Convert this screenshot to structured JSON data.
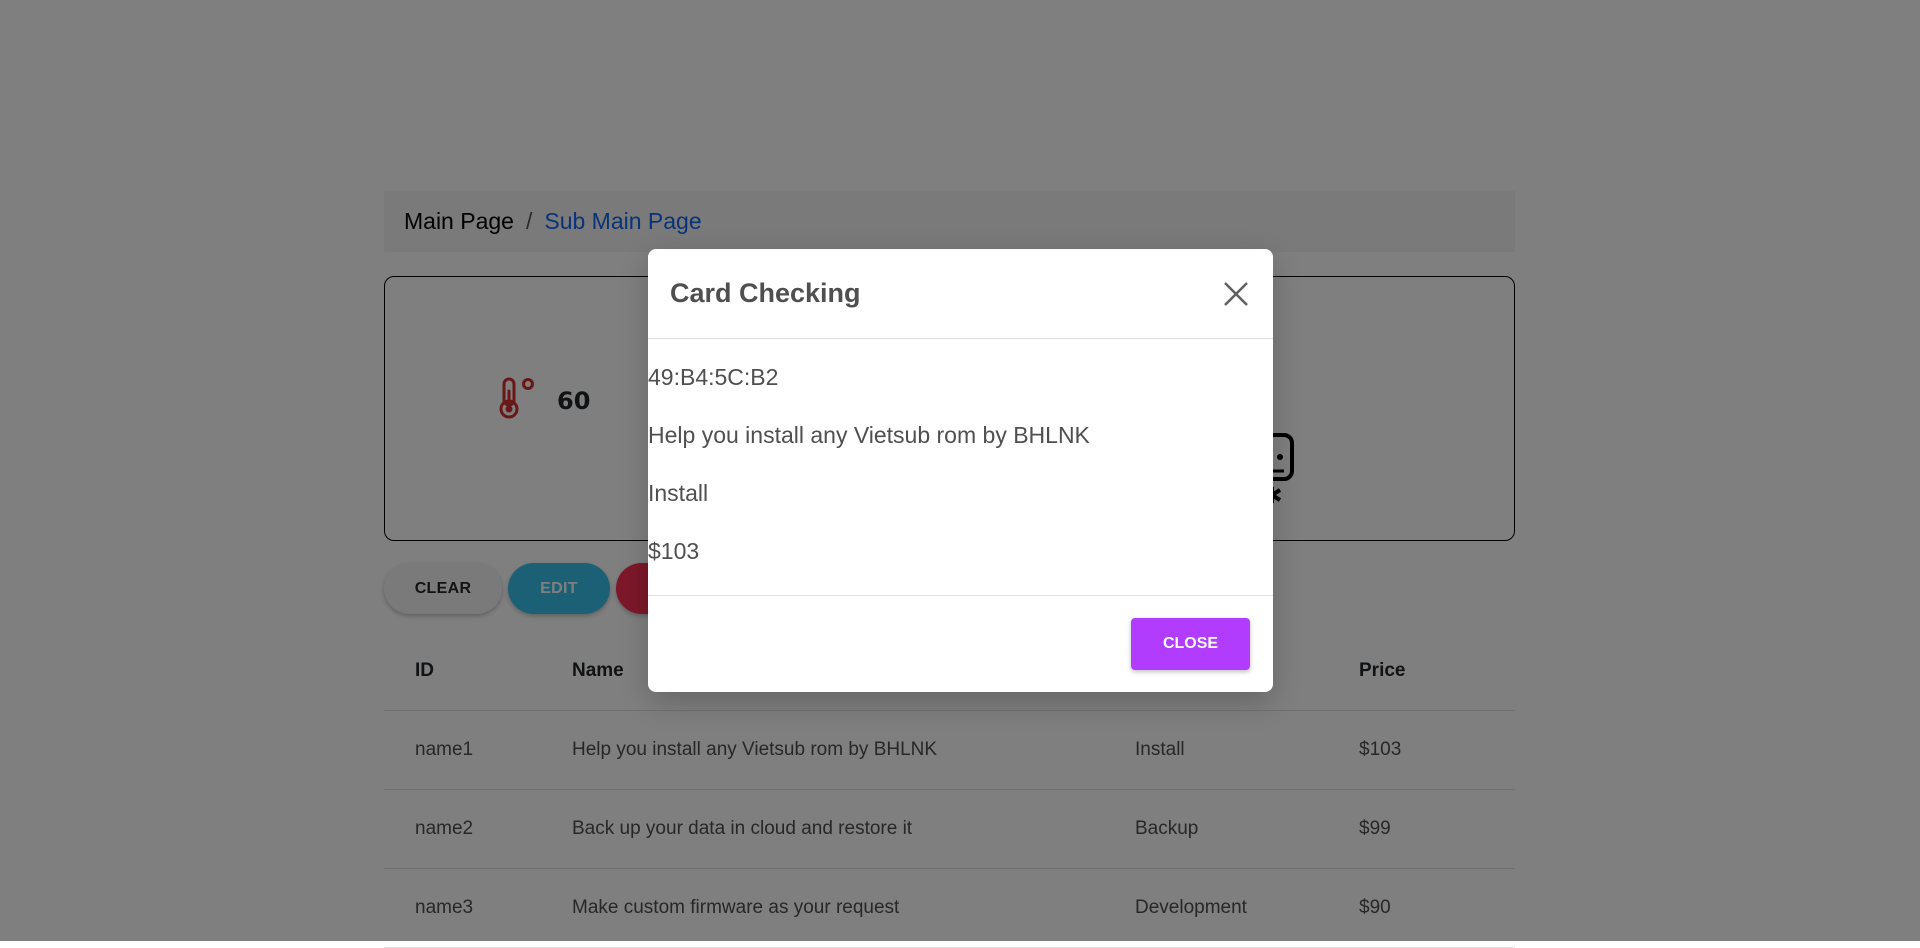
{
  "breadcrumb": {
    "main": "Main Page",
    "separator": "/",
    "sub": "Sub Main Page"
  },
  "card": {
    "temperature_icon": "thermometer-celsius-icon",
    "temperature_value": "60",
    "chip_icon": "chip-icon"
  },
  "buttons": {
    "clear": "CLEAR",
    "edit": "EDIT",
    "delete": ""
  },
  "table": {
    "headers": [
      "ID",
      "Name",
      "",
      "Price"
    ],
    "rows": [
      {
        "id": "name1",
        "name": "Help you install any Vietsub rom by BHLNK",
        "category": "Install",
        "price": "$103"
      },
      {
        "id": "name2",
        "name": "Back up your data in cloud and restore it",
        "category": "Backup",
        "price": "$99"
      },
      {
        "id": "name3",
        "name": "Make custom firmware as your request",
        "category": "Development",
        "price": "$90"
      }
    ]
  },
  "modal": {
    "title": "Card Checking",
    "close_icon": "close-icon",
    "lines": [
      "49:B4:5C:B2",
      "Help you install any Vietsub rom by BHLNK",
      "Install",
      "$103"
    ],
    "close_button": "CLOSE"
  },
  "colors": {
    "accent_link": "#1266f1",
    "edit_button": "#39c0ed",
    "delete_button": "#f93154",
    "close_button": "#b23cfd",
    "thermometer": "#d32f2f"
  }
}
